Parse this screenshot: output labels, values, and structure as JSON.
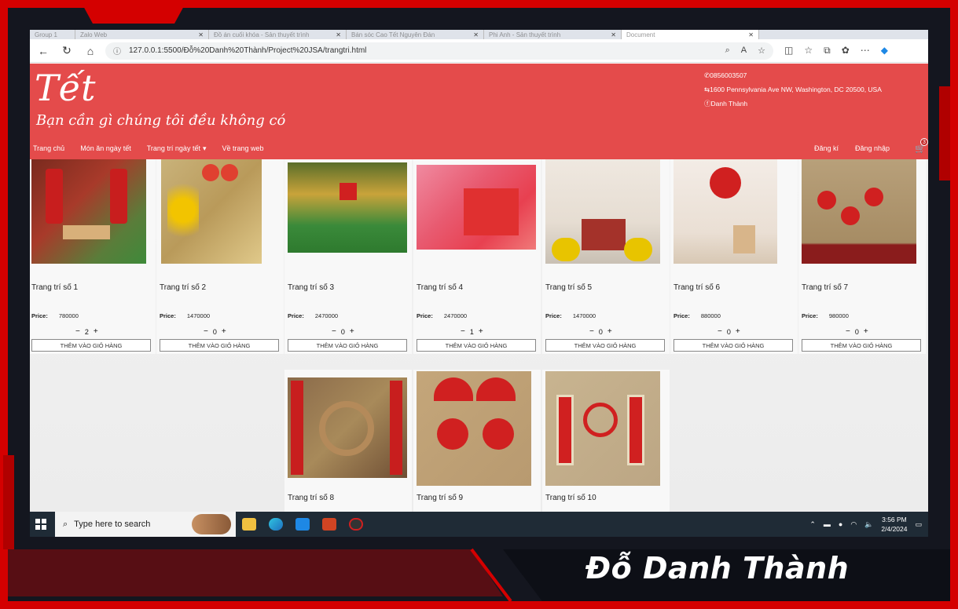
{
  "browser": {
    "tabs": [
      {
        "label": "Group 1"
      },
      {
        "label": "Zalo Web"
      },
      {
        "label": "Đồ án cuối khóa - Sản thuyết trình"
      },
      {
        "label": "Bán sóc Cao Tết Nguyên Đán"
      },
      {
        "label": "Phi Anh - Sản thuyết trình"
      },
      {
        "label": "Document"
      }
    ],
    "url": "127.0.0.1:5500/Đỗ%20Danh%20Thành/Project%20JSA/trangtri.html"
  },
  "site": {
    "logo": "Tết",
    "tagline": "Bạn cần gì chúng tôi đều không có",
    "phone": "0856003507",
    "address": "1600 Pennsylvania Ave NW, Washington, DC 20500, USA",
    "facebook": "Danh Thành",
    "nav": {
      "home": "Trang chủ",
      "food": "Món ăn ngày tết",
      "decor": "Trang trí ngày tết",
      "about": "Về trang web",
      "register": "Đăng kí",
      "login": "Đăng nhập"
    },
    "cart_count": "3"
  },
  "products": [
    {
      "name": "Trang trí số 1",
      "price_label": "Price:",
      "price": "780000",
      "qty": "2",
      "button": "THÊM VÀO GIỎ HÀNG"
    },
    {
      "name": "Trang trí số 2",
      "price_label": "Price:",
      "price": "1470000",
      "qty": "0",
      "button": "THÊM VÀO GIỎ HÀNG"
    },
    {
      "name": "Trang trí số 3",
      "price_label": "Price:",
      "price": "2470000",
      "qty": "0",
      "button": "THÊM VÀO GIỎ HÀNG"
    },
    {
      "name": "Trang trí số 4",
      "price_label": "Price:",
      "price": "2470000",
      "qty": "1",
      "button": "THÊM VÀO GIỎ HÀNG"
    },
    {
      "name": "Trang trí số 5",
      "price_label": "Price:",
      "price": "1470000",
      "qty": "0",
      "button": "THÊM VÀO GIỎ HÀNG"
    },
    {
      "name": "Trang trí số 6",
      "price_label": "Price:",
      "price": "880000",
      "qty": "0",
      "button": "THÊM VÀO GIỎ HÀNG"
    },
    {
      "name": "Trang trí số 7",
      "price_label": "Price:",
      "price": "980000",
      "qty": "0",
      "button": "THÊM VÀO GIỎ HÀNG"
    },
    {
      "name": "Trang trí số 8"
    },
    {
      "name": "Trang trí số 9"
    },
    {
      "name": "Trang trí số 10"
    }
  ],
  "taskbar": {
    "search_placeholder": "Type here to search",
    "time": "3:56 PM",
    "date": "2/4/2024"
  },
  "overlay": {
    "author": "Đỗ Danh Thành"
  },
  "colors": {
    "header_red": "#e44b4b",
    "frame_red": "#d40000"
  }
}
